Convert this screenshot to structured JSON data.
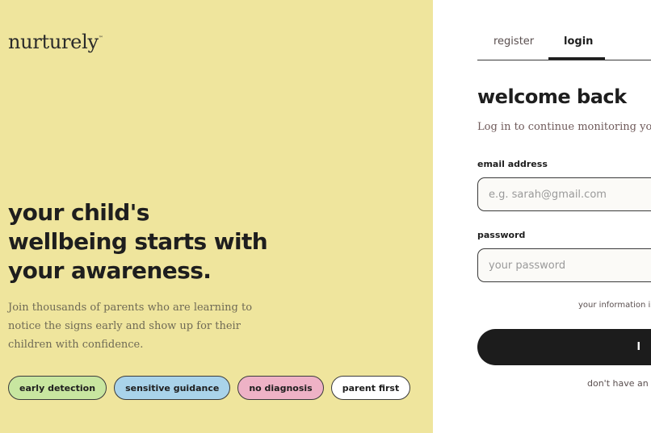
{
  "brand": {
    "name": "nurturely",
    "trademark": "™"
  },
  "hero": {
    "headline": "your child's wellbeing starts with your awareness.",
    "description": "Join thousands of parents who are learning to notice the signs early and show up for their children with confidence.",
    "tags": [
      {
        "label": "early detection",
        "color": "#c8e6a0"
      },
      {
        "label": "sensitive guidance",
        "color": "#a9d3ea"
      },
      {
        "label": "no diagnosis",
        "color": "#eeb2c6"
      },
      {
        "label": "parent first",
        "color": "#ffffff"
      }
    ]
  },
  "auth": {
    "tabs": {
      "register": "register",
      "login": "login",
      "active": "login"
    },
    "title": "welcome back",
    "subtitle": "Log in to continue monitoring your",
    "email": {
      "label": "email address",
      "placeholder": "e.g. sarah@gmail.com",
      "value": ""
    },
    "password": {
      "label": "password",
      "placeholder": "your password",
      "value": ""
    },
    "info_note": "your information is",
    "submit_label": "l",
    "signup_prompt": "don't have an a"
  },
  "colors": {
    "left_panel": "#efe59d",
    "button": "#1c1c1c",
    "text_dark": "#1e1e1e"
  }
}
